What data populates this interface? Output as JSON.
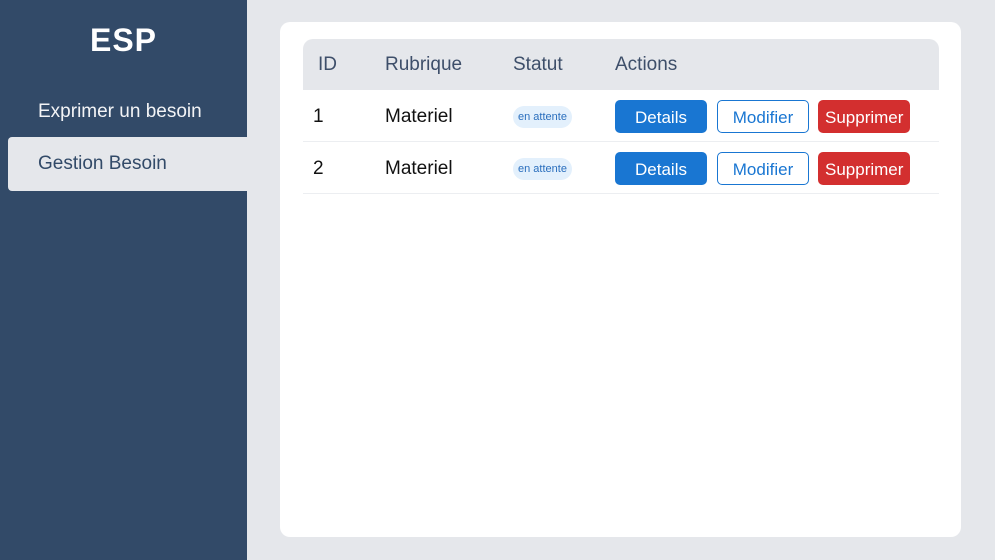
{
  "sidebar": {
    "brand": "ESP",
    "items": [
      {
        "label": "Exprimer un besoin",
        "active": false
      },
      {
        "label": "Gestion Besoin",
        "active": true
      }
    ]
  },
  "table": {
    "headers": {
      "id": "ID",
      "rubrique": "Rubrique",
      "statut": "Statut",
      "actions": "Actions"
    },
    "rows": [
      {
        "id": "1",
        "rubrique": "Materiel",
        "statut": "en attente"
      },
      {
        "id": "2",
        "rubrique": "Materiel",
        "statut": "en attente"
      }
    ],
    "actions": {
      "details": "Details",
      "modifier": "Modifier",
      "supprimer": "Supprimer"
    }
  },
  "colors": {
    "sidebar_bg": "#324a68",
    "primary": "#1976d2",
    "danger": "#d32f2f",
    "badge_bg": "#e3f0fc"
  }
}
